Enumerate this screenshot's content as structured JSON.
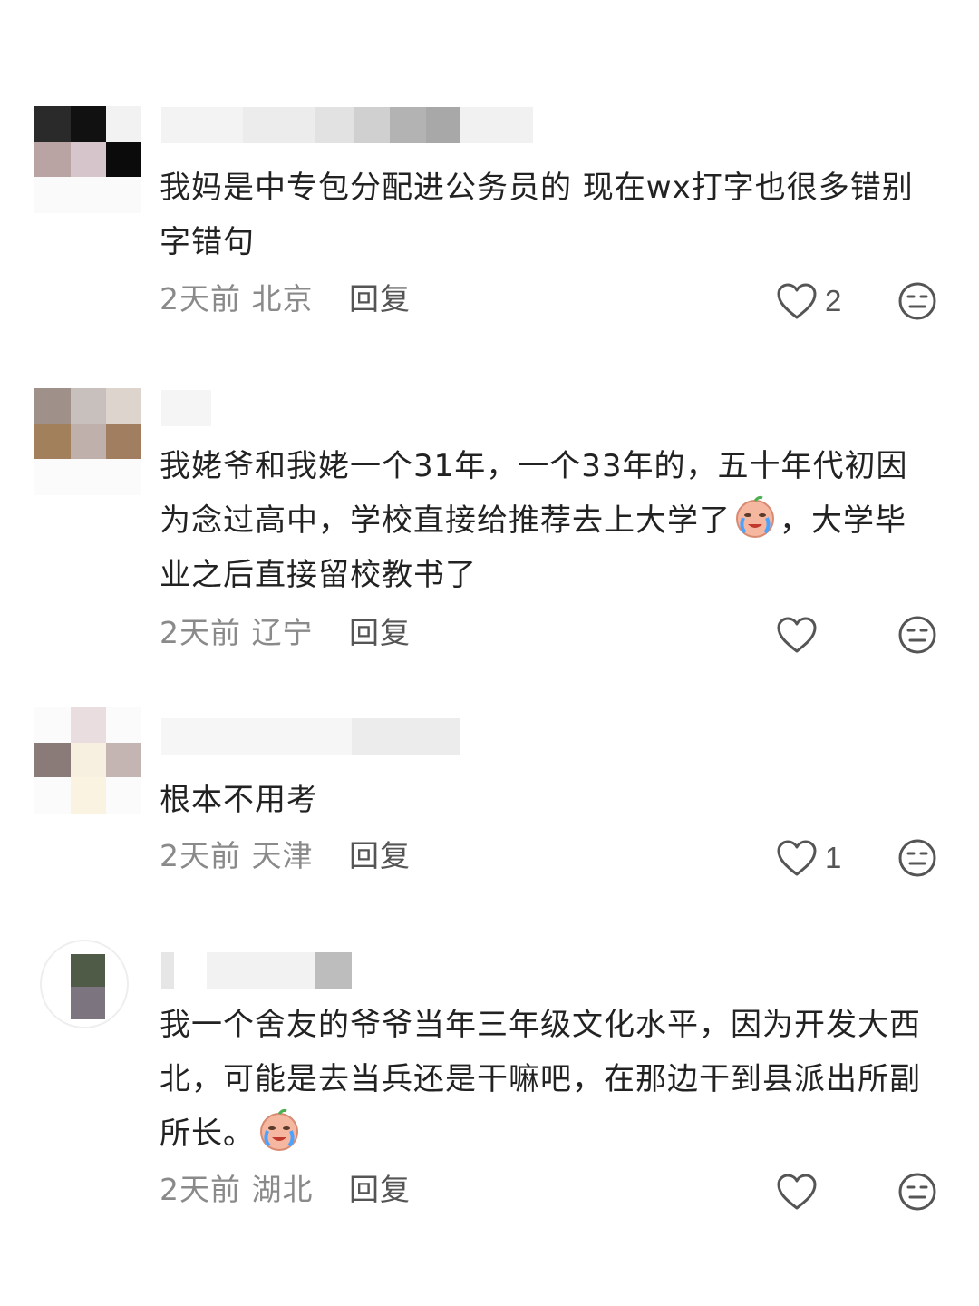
{
  "comments": [
    {
      "text": "我妈是中专包分配进公务员的 现在wx打字也很多错别字错句",
      "time": "2天前",
      "location": "北京",
      "reply_label": "回复",
      "likes": "2"
    },
    {
      "text_before_emoji": "我姥爷和我姥一个31年，一个33年的，五十年代初因为念过高中，学校直接给推荐去上大学了",
      "emoji": "crying-emoji",
      "text_after_emoji": "，大学毕业之后直接留校教书了",
      "time": "2天前",
      "location": "辽宁",
      "reply_label": "回复",
      "likes": ""
    },
    {
      "text": "根本不用考",
      "time": "2天前",
      "location": "天津",
      "reply_label": "回复",
      "likes": "1"
    },
    {
      "text_before_emoji": "我一个舍友的爷爷当年三年级文化水平，因为开发大西北，可能是去当兵还是干嘛吧，在那边干到县派出所副所长。",
      "emoji": "crying-emoji",
      "time": "2天前",
      "location": "湖北",
      "reply_label": "回复",
      "likes": ""
    }
  ],
  "colors": {
    "text": "#222222",
    "meta": "#8a8a8a",
    "icon": "#555555"
  }
}
